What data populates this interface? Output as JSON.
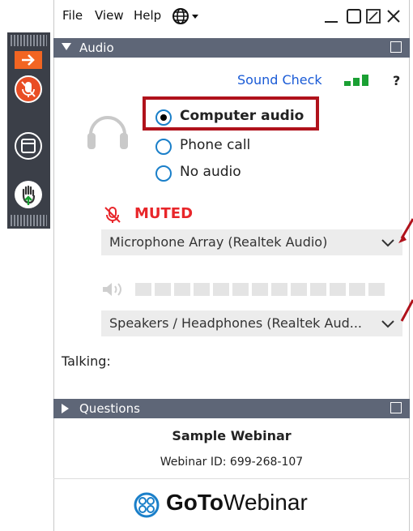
{
  "menu": {
    "file": "File",
    "view": "View",
    "help": "Help"
  },
  "panels": {
    "audio": "Audio",
    "questions": "Questions"
  },
  "sound_check": "Sound Check",
  "help_glyph": "?",
  "audio_options": [
    {
      "label": "Computer audio",
      "selected": true
    },
    {
      "label": "Phone call",
      "selected": false
    },
    {
      "label": "No audio",
      "selected": false
    }
  ],
  "mute_status": "MUTED",
  "microphone": "Microphone Array (Realtek Audio)",
  "speakers": "Speakers / Headphones (Realtek Aud...",
  "talking_label": "Talking:",
  "webinar": {
    "title": "Sample Webinar",
    "id_text": "Webinar ID: 699-268-107"
  },
  "logo": {
    "goto": "GoTo",
    "webinar": "Webinar"
  },
  "colors": {
    "accent": "#1a7fc9",
    "muted": "#e8262a",
    "highlight": "#b0121b",
    "header": "#5e6677",
    "signal": "#1aa033"
  },
  "signal_level": 0.75
}
